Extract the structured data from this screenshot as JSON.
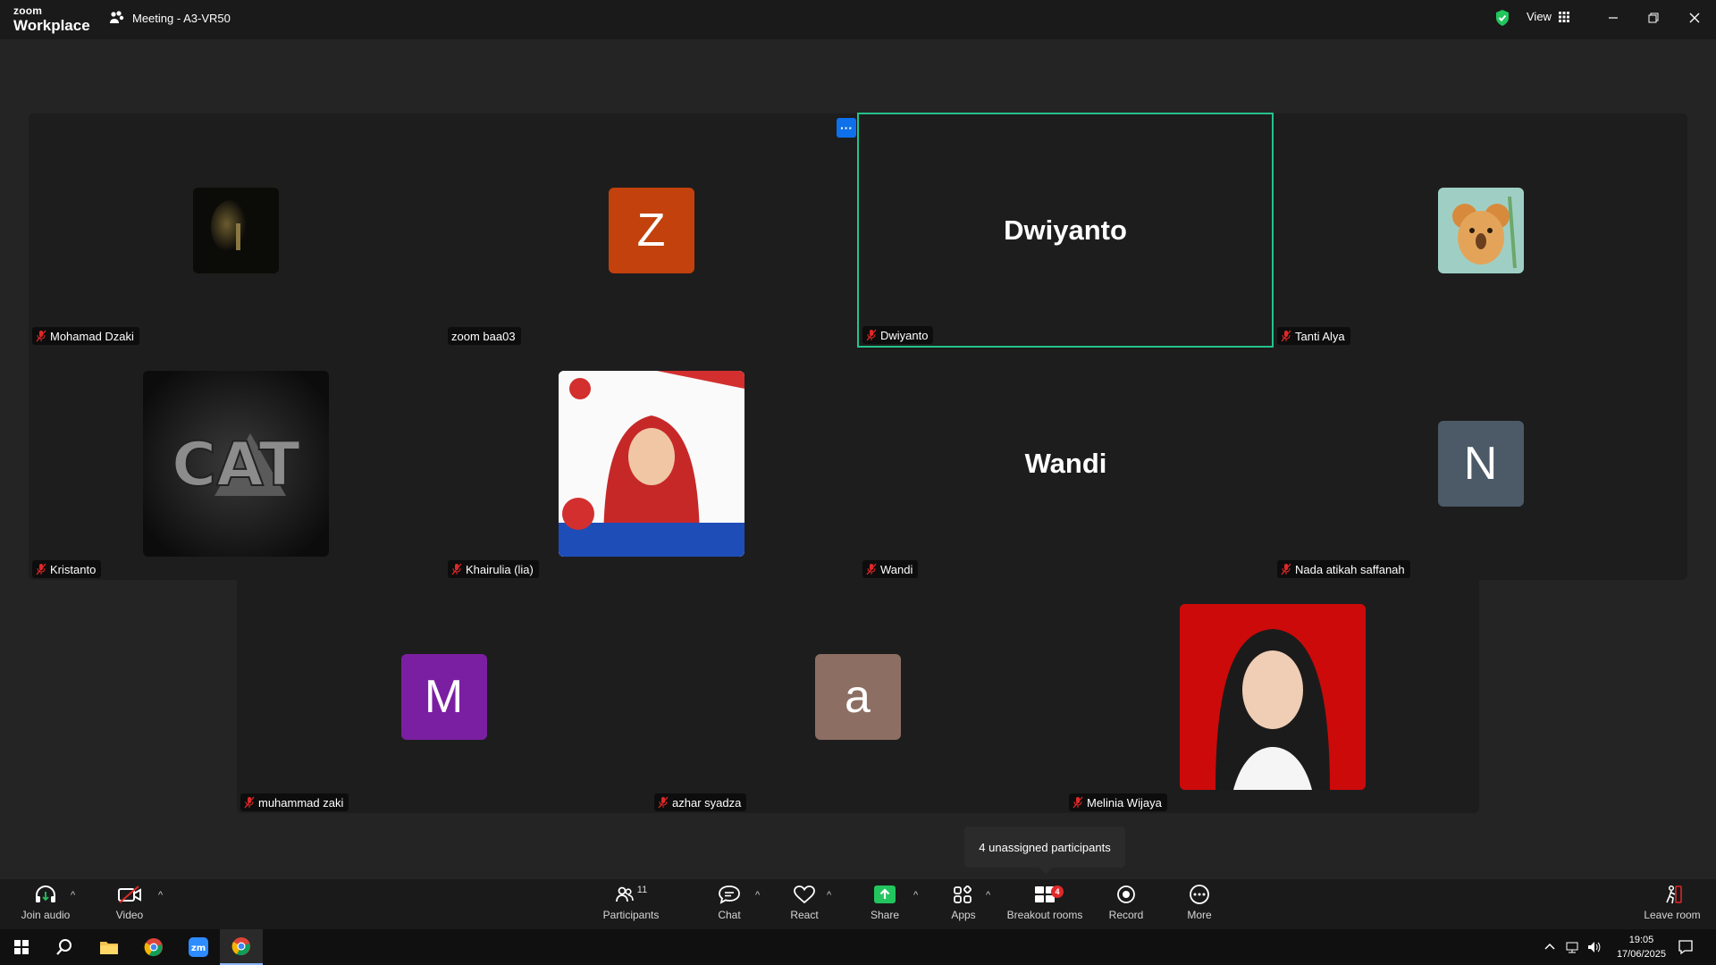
{
  "app": {
    "logo_line1": "zoom",
    "logo_line2": "Workplace",
    "meeting_title": "Meeting - A3-VR50",
    "view_label": "View"
  },
  "tiles": [
    {
      "name": "Mohamad Dzaki",
      "avatar": "photo-dark-face"
    },
    {
      "name": "zoom baa03",
      "avatar_letter": "Z",
      "avatar_color": "#c2410c"
    },
    {
      "name": "Dwiyanto",
      "big_name": "Dwiyanto",
      "active": true
    },
    {
      "name": "Tanti Alya",
      "avatar": "photo-koala"
    },
    {
      "name": "Kristanto",
      "avatar": "photo-cat-logo"
    },
    {
      "name": "Khairulia (lia)",
      "avatar": "photo-hijab"
    },
    {
      "name": "Wandi",
      "big_name": "Wandi"
    },
    {
      "name": "Nada atikah saffanah",
      "avatar_letter": "N",
      "avatar_color": "#4b5a66"
    },
    {
      "name": "muhammad zaki",
      "avatar_letter": "M",
      "avatar_color": "#7b1fa2"
    },
    {
      "name": "azhar syadza",
      "avatar_letter": "a",
      "avatar_color": "#8d6e63"
    },
    {
      "name": "Melinia Wijaya",
      "avatar": "photo-red-bg"
    }
  ],
  "cat_text": "CAT",
  "tooltip": "4 unassigned participants",
  "toolbar": {
    "join_audio": "Join audio",
    "video": "Video",
    "participants": "Participants",
    "participants_count": "11",
    "chat": "Chat",
    "react": "React",
    "share": "Share",
    "apps": "Apps",
    "breakout_rooms": "Breakout rooms",
    "breakout_badge": "4",
    "record": "Record",
    "more": "More",
    "leave_room": "Leave room"
  },
  "taskbar": {
    "time": "19:05",
    "date": "17/06/2025"
  },
  "colors": {
    "active_border": "#25c28a",
    "accent_blue": "#0e71eb",
    "share_green": "#22c55e",
    "mute_red": "#e02828"
  }
}
